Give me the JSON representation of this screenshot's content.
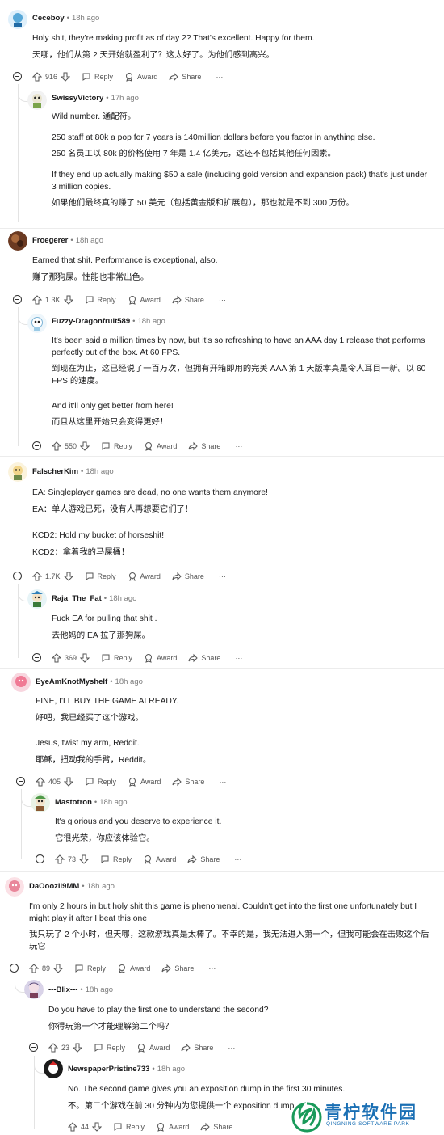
{
  "comments": [
    {
      "username": "Ceceboy",
      "time": "18h ago",
      "lines": [
        "Holy shit, they're making profit as of day 2? That's excellent. Happy for them.",
        "天哪，他们从第 2 天开始就盈利了？这太好了。为他们感到高兴。"
      ],
      "votes": "916"
    },
    {
      "username": "SwissyVictory",
      "time": "17h ago",
      "lines": [
        "Wild number.  通配符。",
        "",
        "250 staff at 80k a pop for 7 years is 140million dollars before you factor in anything else.",
        "250 名员工以 80k 的价格使用 7 年是 1.4 亿美元，这还不包括其他任何因素。",
        "",
        "If they end up actually making $50 a sale (including gold version and expansion pack) that's just under 3 million copies.",
        "如果他们最终真的赚了 50 美元（包括黄金版和扩展包），那也就是不到 300 万份。"
      ],
      "votes": ""
    },
    {
      "username": "Froegerer",
      "time": "18h ago",
      "lines": [
        "Earned that shit. Performance is exceptional, also.",
        "赚了那狗屎。性能也非常出色。"
      ],
      "votes": "1.3K"
    },
    {
      "username": "Fuzzy-Dragonfruit589",
      "time": "18h ago",
      "lines": [
        "It's been said a million times by now, but it's so refreshing to have an AAA day 1 release that performs perfectly out of the box. At 60 FPS.",
        "到现在为止，这已经说了一百万次，但拥有开箱即用的完美 AAA 第 1 天版本真是令人耳目一新。以 60 FPS 的速度。",
        "",
        "And it'll only get better from here!",
        "而且从这里开始只会变得更好！"
      ],
      "votes": "550"
    },
    {
      "username": "FalscherKim",
      "time": "18h ago",
      "lines": [
        "EA: Singleplayer games are dead, no one wants them anymore!",
        "EA：单人游戏已死，没有人再想要它们了！",
        "",
        "KCD2: Hold my bucket of horseshit!",
        "KCD2：拿着我的马屎桶！"
      ],
      "votes": "1.7K"
    },
    {
      "username": "Raja_The_Fat",
      "time": "18h ago",
      "lines": [
        "Fuck EA for pulling that shit .",
        "去他妈的 EA 拉了那狗屎。"
      ],
      "votes": "369"
    },
    {
      "username": "EyeAmKnotMyshelf",
      "time": "18h ago",
      "lines": [
        "FINE, I'LL BUY THE GAME ALREADY.",
        "好吧，我已经买了这个游戏。",
        "",
        "Jesus, twist my arm, Reddit.",
        "耶稣，扭动我的手臂，Reddit。"
      ],
      "votes": "405"
    },
    {
      "username": "Mastotron",
      "time": "18h ago",
      "lines": [
        "It's glorious and you deserve to experience it.",
        "它很光荣，你应该体验它。"
      ],
      "votes": "73"
    },
    {
      "username": "DaOoozii9MM",
      "time": "18h ago",
      "lines": [
        "I'm only 2 hours in but holy shit this game is phenomenal. Couldn't get into the first one unfortunately but I might play it after I beat this one",
        "我只玩了 2 个小时，但天哪，这款游戏真是太棒了。不幸的是，我无法进入第一个，但我可能会在击败这个后玩它"
      ],
      "votes": "89"
    },
    {
      "username": "---Blix---",
      "time": "18h ago",
      "lines": [
        "Do you have to play the first one to understand the second?",
        "你得玩第一个才能理解第二个吗？"
      ],
      "votes": "23"
    },
    {
      "username": "NewspaperPristine733",
      "time": "18h ago",
      "lines": [
        "No. The second game gives you an exposition dump in the first 30 minutes.",
        "不。第二个游戏在前 30 分钟内为您提供一个 exposition dump"
      ],
      "votes": "44"
    }
  ],
  "actions": {
    "reply": "Reply",
    "award": "Award",
    "share": "Share",
    "more": "···"
  },
  "watermark": {
    "title": "青柠软件园",
    "subtitle": "QINGNING SOFTWARE PARK"
  },
  "colors": {
    "text": "#1a1a1b",
    "meta": "#7c7c7c",
    "thread": "#e3e3e3",
    "watermark": "#1a6fb4"
  }
}
